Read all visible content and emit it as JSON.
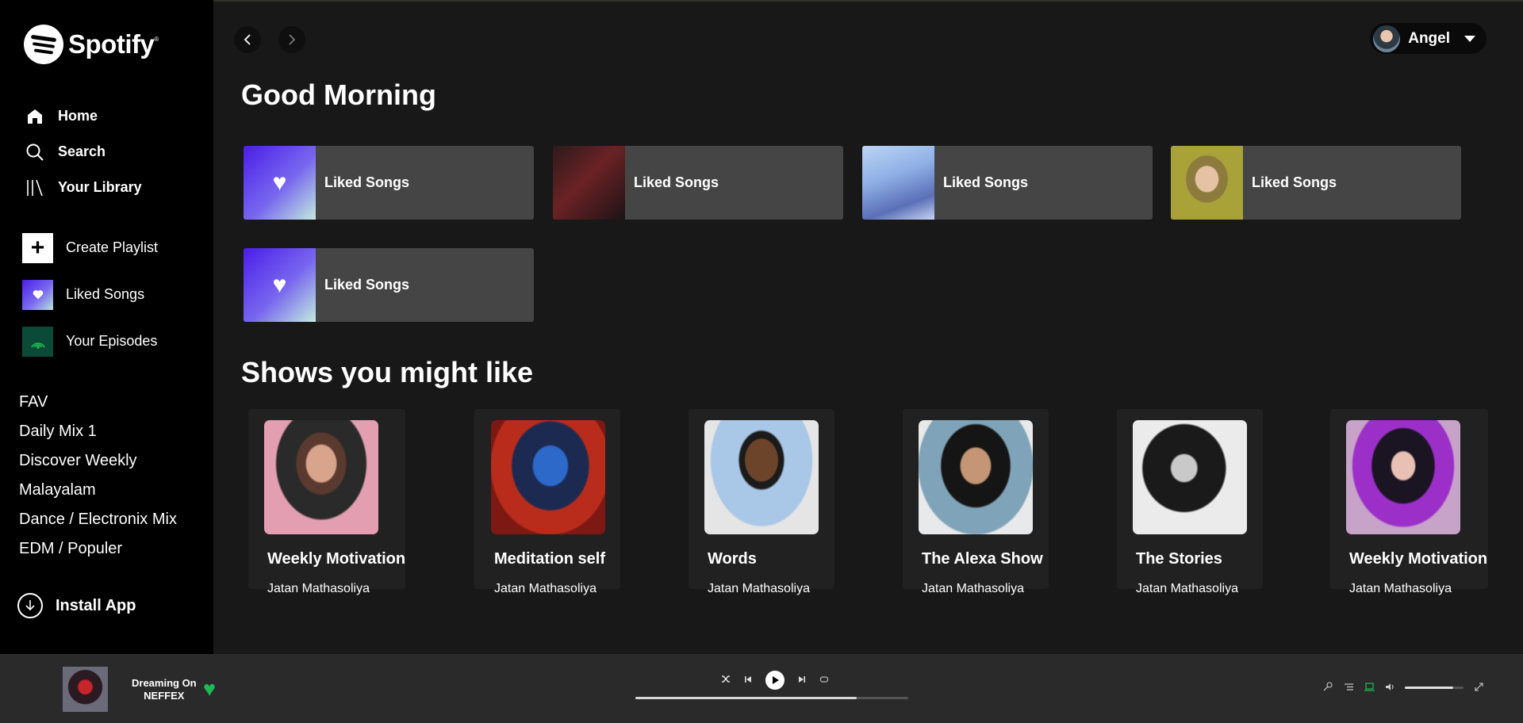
{
  "brand": {
    "name": "Spotify",
    "trademark": "®"
  },
  "nav": [
    {
      "label": "Home",
      "icon": "home-icon"
    },
    {
      "label": "Search",
      "icon": "search-icon"
    },
    {
      "label": "Your Library",
      "icon": "library-icon"
    }
  ],
  "actions": [
    {
      "label": "Create Playlist",
      "icon": "plus-icon"
    },
    {
      "label": "Liked Songs",
      "icon": "heart-icon"
    },
    {
      "label": "Your Episodes",
      "icon": "podcast-icon"
    }
  ],
  "playlists": [
    "FAV",
    "Daily Mix 1",
    "Discover Weekly",
    "Malayalam",
    "Dance / Electronix Mix",
    "EDM / Populer"
  ],
  "install": {
    "label": "Install App",
    "icon": "download-icon"
  },
  "header": {
    "back_icon": "chevron-left-icon",
    "forward_icon": "chevron-right-icon",
    "user_name": "Angel"
  },
  "greeting": "Good Morning",
  "quick_picks": [
    {
      "label": "Liked Songs"
    },
    {
      "label": "Liked Songs"
    },
    {
      "label": "Liked Songs"
    },
    {
      "label": "Liked Songs"
    },
    {
      "label": "Liked Songs"
    }
  ],
  "shows_heading": "Shows you might like",
  "shows": [
    {
      "title": "Weekly Motivation",
      "author": "Jatan Mathasoliya"
    },
    {
      "title": "Meditation self",
      "author": "Jatan Mathasoliya"
    },
    {
      "title": "Words",
      "author": "Jatan Mathasoliya"
    },
    {
      "title": "The Alexa Show",
      "author": "Jatan Mathasoliya"
    },
    {
      "title": "The Stories",
      "author": "Jatan Mathasoliya"
    },
    {
      "title": "Weekly Motivation",
      "author": "Jatan Mathasoliya"
    }
  ],
  "player": {
    "track": "Dreaming On",
    "artist": "NEFFEX",
    "progress_percent": 81,
    "volume_percent": 82
  },
  "colors": {
    "accent": "#1db954",
    "sidebar": "#000000",
    "main": "#181818",
    "player": "#2a2a2a"
  }
}
